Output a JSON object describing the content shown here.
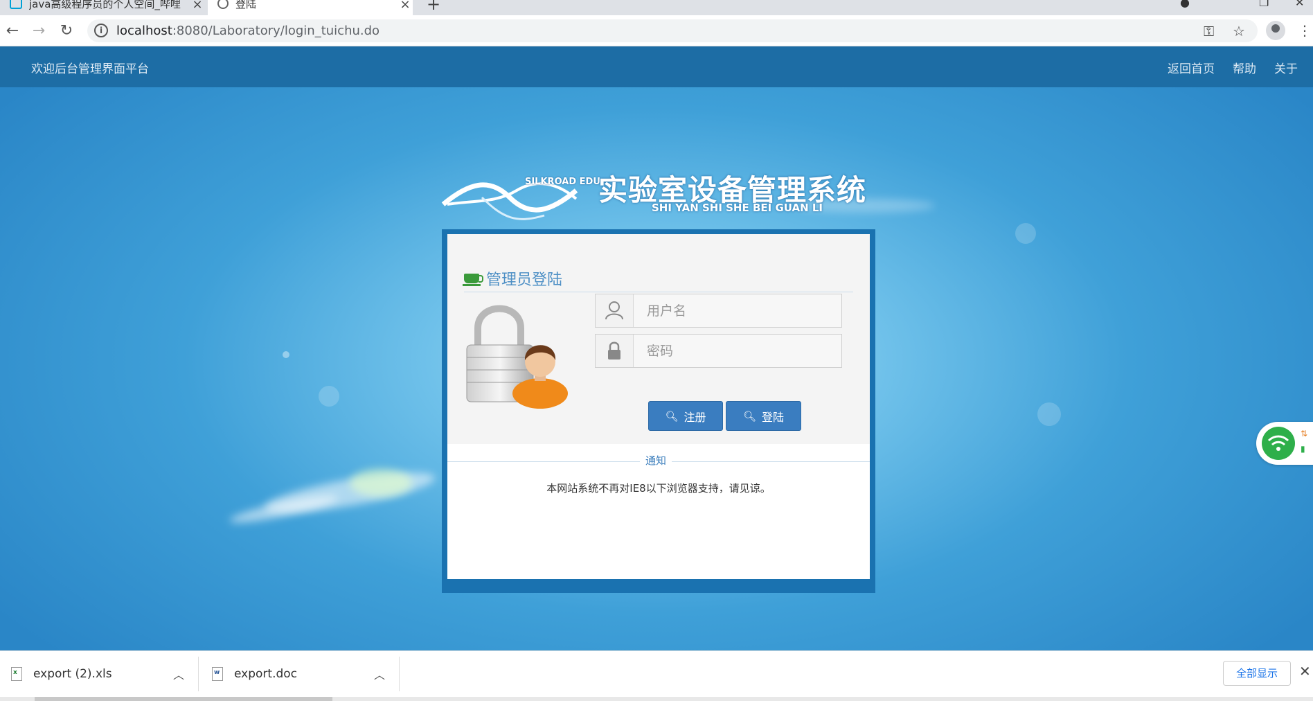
{
  "browser": {
    "tabs": [
      {
        "title": "java高级程序员的个人空间_哔哩",
        "active": false
      },
      {
        "title": "登陆",
        "active": true
      }
    ],
    "url_host": "localhost",
    "url_path": ":8080/Laboratory/login_tuichu.do"
  },
  "header": {
    "brand": "欢迎后台管理界面平台",
    "links": [
      "返回首页",
      "帮助",
      "关于"
    ]
  },
  "logo": {
    "edu_text": "SILKROAD EDU",
    "title": "实验室设备管理系统",
    "subtitle": "SHI YAN SHI SHE BEI GUAN LI"
  },
  "login": {
    "title": "管理员登陆",
    "username_placeholder": "用户名",
    "password_placeholder": "密码",
    "register_label": "注册",
    "login_label": "登陆"
  },
  "notice": {
    "label": "通知",
    "text": "本网站系统不再对IE8以下浏览器支持，请见谅。"
  },
  "downloads": {
    "items": [
      {
        "name": "export (2).xls",
        "type": "xls"
      },
      {
        "name": "export.doc",
        "type": "doc"
      }
    ],
    "show_all": "全部显示"
  },
  "colors": {
    "nav_bar": "#1d6da5",
    "frame": "#1a72b0",
    "button": "#3a7dc0",
    "title_text": "#4d8fc5"
  }
}
